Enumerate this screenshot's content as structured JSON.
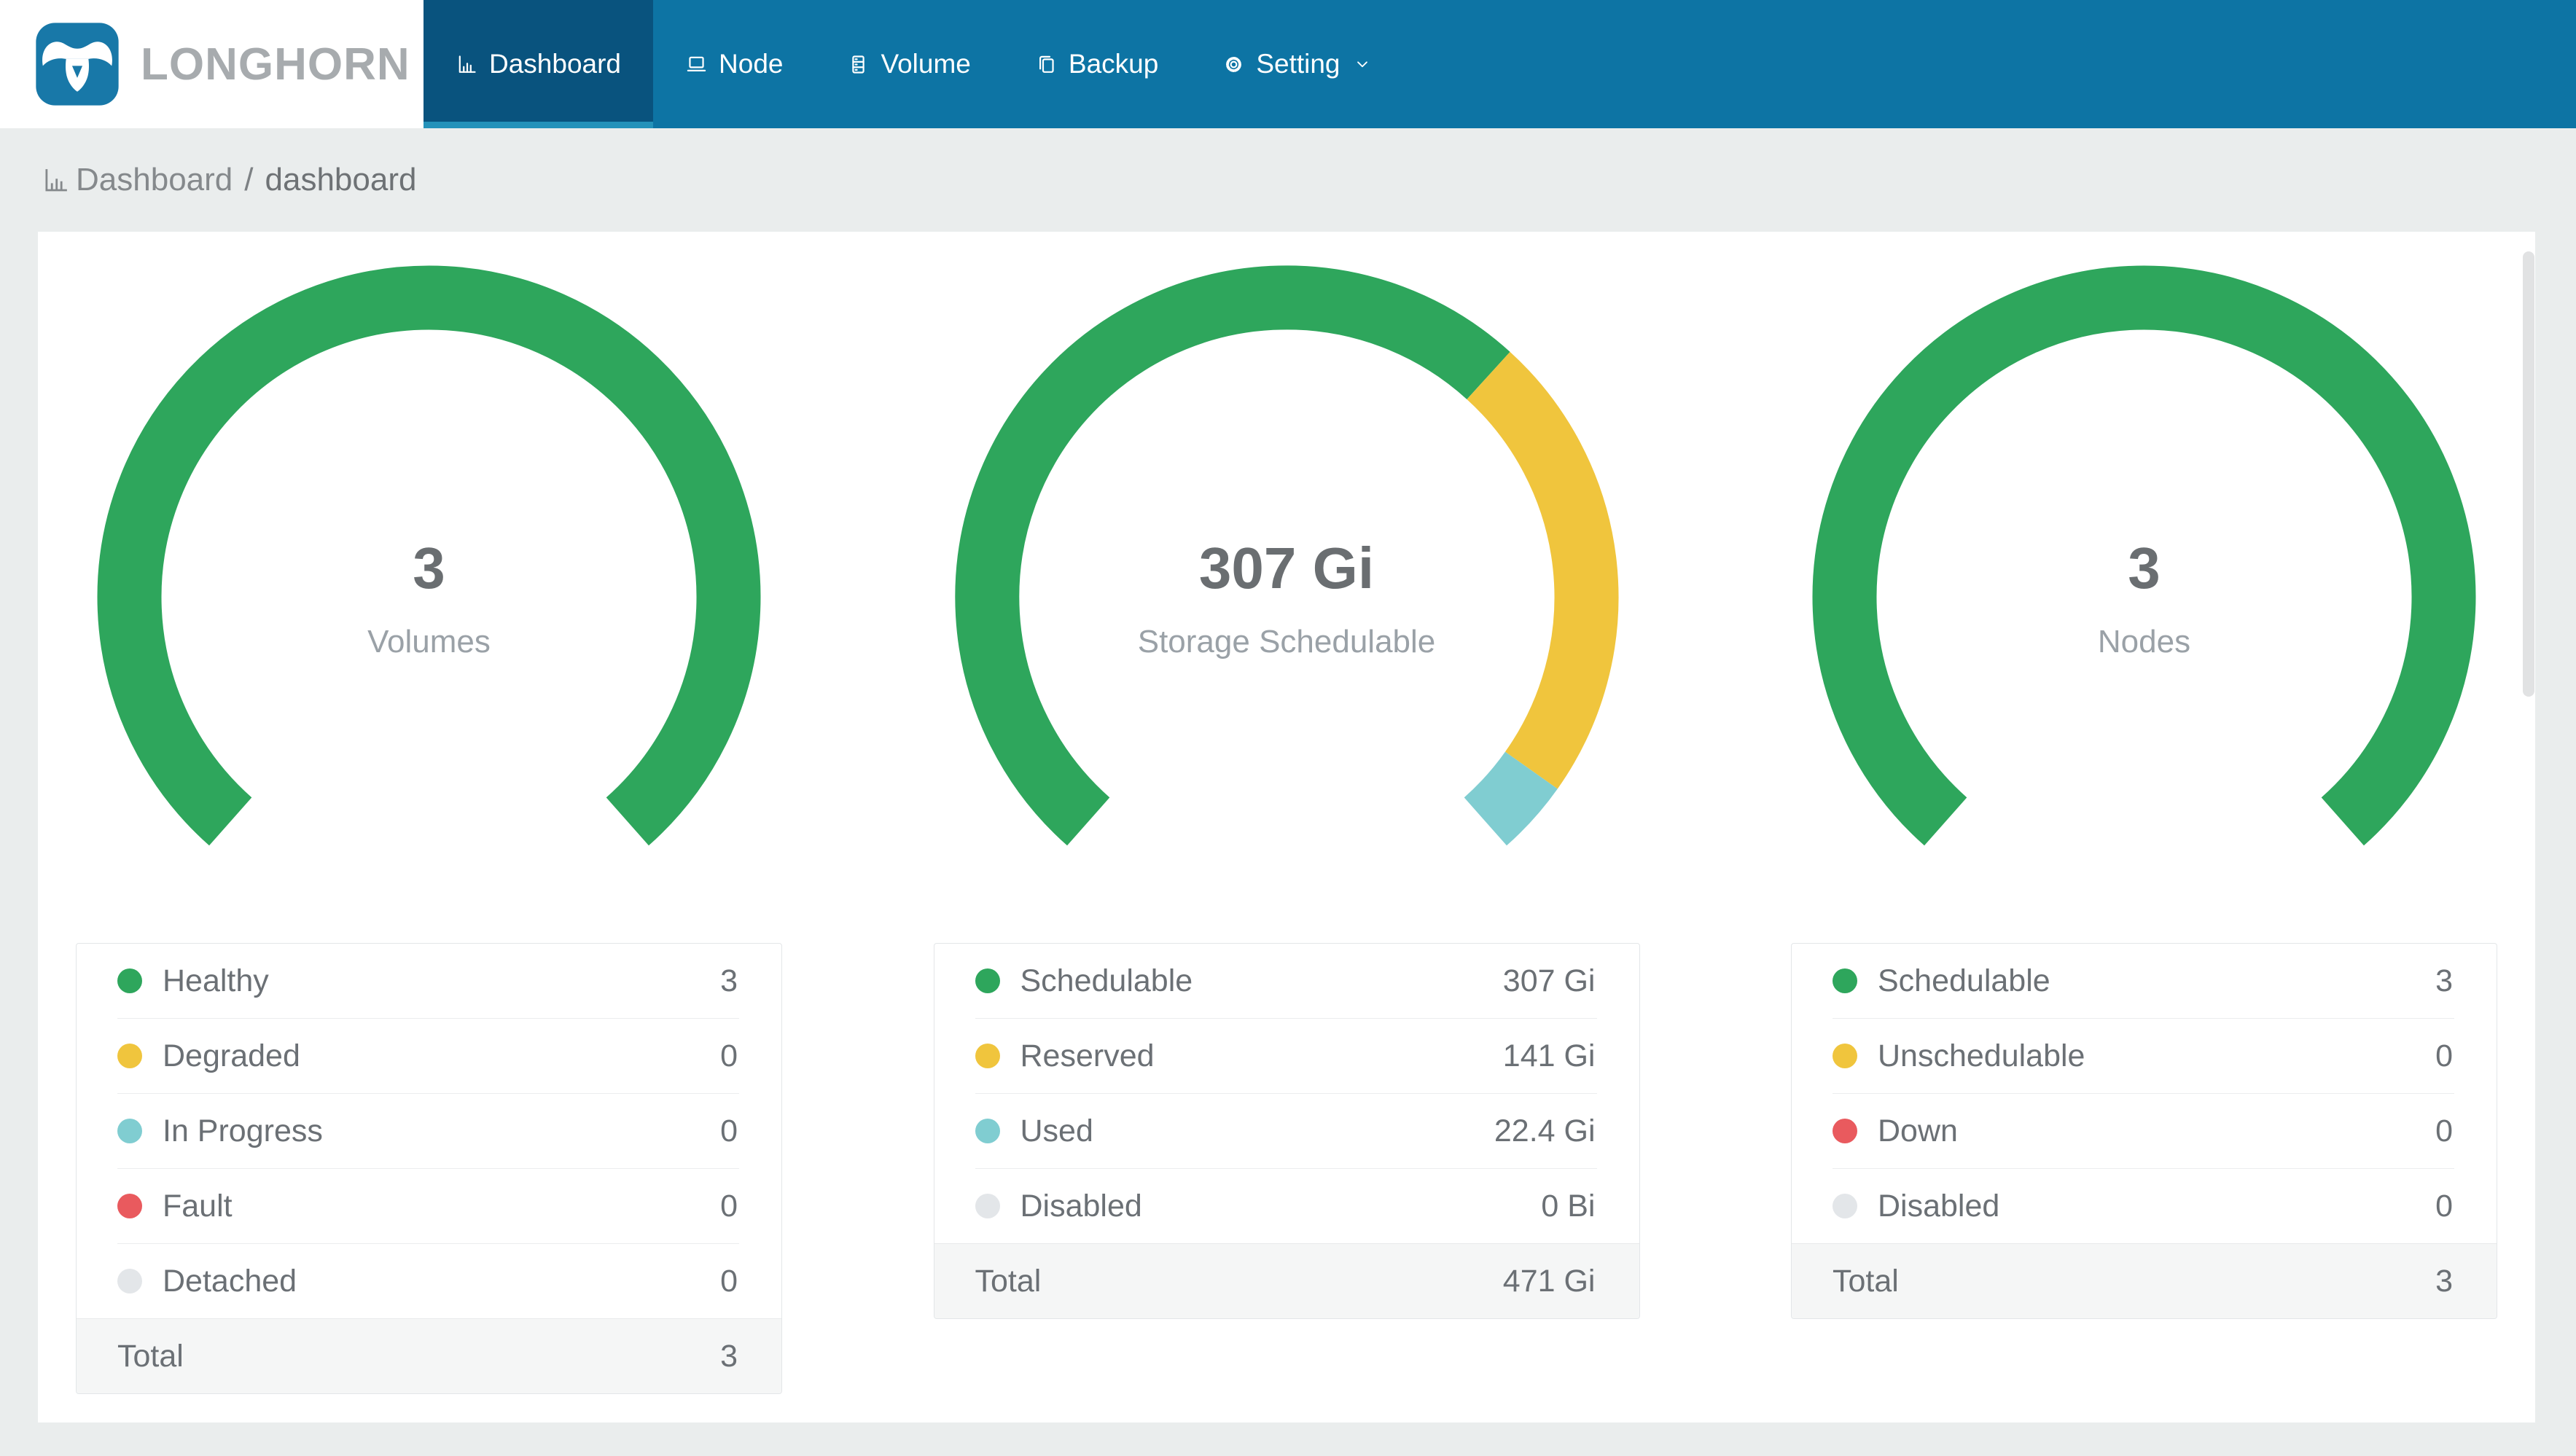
{
  "brand": {
    "name": "LONGHORN",
    "logo_icon": "bull-skull-icon"
  },
  "nav": {
    "items": [
      {
        "label": "Dashboard",
        "icon": "bar-chart-icon",
        "active": true,
        "has_chevron": false
      },
      {
        "label": "Node",
        "icon": "laptop-icon",
        "active": false,
        "has_chevron": false
      },
      {
        "label": "Volume",
        "icon": "server-icon",
        "active": false,
        "has_chevron": false
      },
      {
        "label": "Backup",
        "icon": "copy-icon",
        "active": false,
        "has_chevron": false
      },
      {
        "label": "Setting",
        "icon": "gear-icon",
        "active": false,
        "has_chevron": true
      }
    ]
  },
  "breadcrumb": {
    "icon": "bar-chart-icon",
    "section": "Dashboard",
    "separator": "/",
    "page": "dashboard"
  },
  "colors": {
    "nav_bg": "#0d74a4",
    "nav_active_bg": "#09537e",
    "nav_active_strip": "#2492ba",
    "logo_blue": "#1878a8",
    "green": "#2ea65c",
    "yellow": "#f0c53d",
    "teal": "#80cdd1",
    "red": "#e95a5e",
    "gray": "#e3e6e9"
  },
  "gauge_geometry": {
    "arc_degrees": 277,
    "start_angle_deg": 131.5
  },
  "chart_data": [
    {
      "type": "gauge",
      "title": "Volumes",
      "center_value": "3",
      "categories": [
        "Healthy",
        "Degraded",
        "In Progress",
        "Fault",
        "Detached"
      ],
      "values": [
        3,
        0,
        0,
        0,
        0
      ],
      "total": 3
    },
    {
      "type": "gauge",
      "title": "Storage Schedulable",
      "center_value": "307 Gi",
      "categories": [
        "Schedulable",
        "Reserved",
        "Used",
        "Disabled"
      ],
      "values": [
        307,
        141,
        22.4,
        0
      ],
      "units": "Gi",
      "total": "471 Gi"
    },
    {
      "type": "gauge",
      "title": "Nodes",
      "center_value": "3",
      "categories": [
        "Schedulable",
        "Unschedulable",
        "Down",
        "Disabled"
      ],
      "values": [
        3,
        0,
        0,
        0
      ],
      "total": 3
    }
  ],
  "panels": [
    {
      "gauge": {
        "value": "3",
        "label": "Volumes"
      },
      "rows": [
        {
          "label": "Healthy",
          "display": "3",
          "numeric": 3,
          "color_key": "green"
        },
        {
          "label": "Degraded",
          "display": "0",
          "numeric": 0,
          "color_key": "yellow"
        },
        {
          "label": "In Progress",
          "display": "0",
          "numeric": 0,
          "color_key": "teal"
        },
        {
          "label": "Fault",
          "display": "0",
          "numeric": 0,
          "color_key": "red"
        },
        {
          "label": "Detached",
          "display": "0",
          "numeric": 0,
          "color_key": "gray"
        }
      ],
      "total": {
        "label": "Total",
        "value": "3"
      }
    },
    {
      "gauge": {
        "value": "307 Gi",
        "label": "Storage Schedulable"
      },
      "rows": [
        {
          "label": "Schedulable",
          "display": "307 Gi",
          "numeric": 307,
          "color_key": "green"
        },
        {
          "label": "Reserved",
          "display": "141 Gi",
          "numeric": 141,
          "color_key": "yellow"
        },
        {
          "label": "Used",
          "display": "22.4 Gi",
          "numeric": 22.4,
          "color_key": "teal"
        },
        {
          "label": "Disabled",
          "display": "0 Bi",
          "numeric": 0,
          "color_key": "gray"
        }
      ],
      "total": {
        "label": "Total",
        "value": "471 Gi"
      }
    },
    {
      "gauge": {
        "value": "3",
        "label": "Nodes"
      },
      "rows": [
        {
          "label": "Schedulable",
          "display": "3",
          "numeric": 3,
          "color_key": "green"
        },
        {
          "label": "Unschedulable",
          "display": "0",
          "numeric": 0,
          "color_key": "yellow"
        },
        {
          "label": "Down",
          "display": "0",
          "numeric": 0,
          "color_key": "red"
        },
        {
          "label": "Disabled",
          "display": "0",
          "numeric": 0,
          "color_key": "gray"
        }
      ],
      "total": {
        "label": "Total",
        "value": "3"
      }
    }
  ]
}
